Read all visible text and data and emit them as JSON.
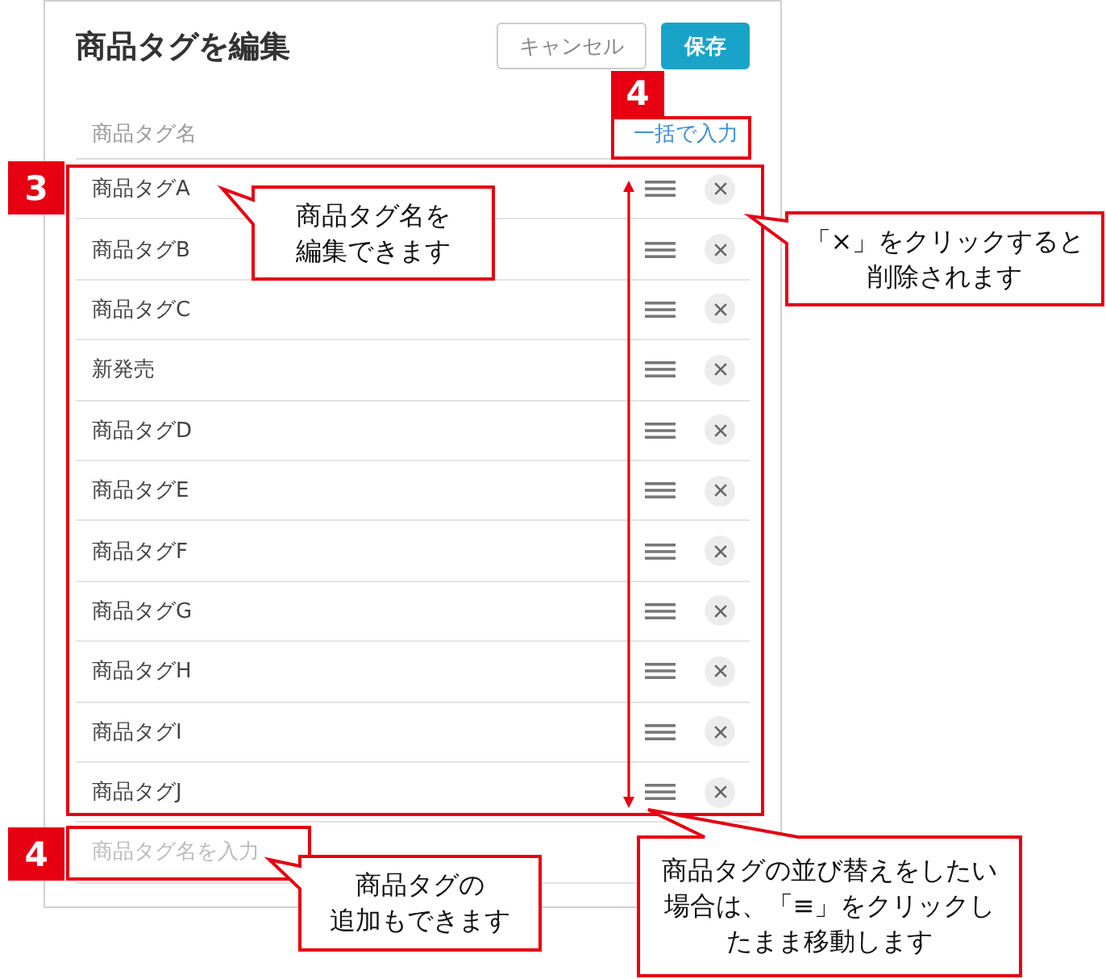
{
  "dialog": {
    "title": "商品タグを編集",
    "buttons": [
      {
        "label": "キャンセル",
        "kind": "secondary"
      },
      {
        "label": "保存",
        "kind": "primary"
      }
    ],
    "column_header": "商品タグ名",
    "bulk_input_link": "一括で入力",
    "tags": [
      "商品タグA",
      "商品タグB",
      "商品タグC",
      "新発売",
      "商品タグD",
      "商品タグE",
      "商品タグF",
      "商品タグG",
      "商品タグH",
      "商品タグI",
      "商品タグJ"
    ],
    "new_tag_field": {
      "placeholder": "商品タグ名を入力"
    }
  },
  "annotations": {
    "markers": [
      {
        "number": "4",
        "kind": "bulk_input"
      },
      {
        "number": "3",
        "kind": "tag_list"
      },
      {
        "number": "4",
        "kind": "new_tag_field"
      }
    ],
    "callouts": [
      {
        "lines": [
          "商品タグ名を",
          "編集できます"
        ],
        "kind": "tag_name"
      },
      {
        "lines": [
          "「×」をクリックすると",
          "削除されます"
        ],
        "kind": "delete_button"
      },
      {
        "lines": [
          "商品タグの",
          "追加もできます"
        ],
        "kind": "new_tag_field"
      },
      {
        "lines": [
          "商品タグの並び替えをしたい",
          "場合は、「≡」をクリックし",
          "たまま移動します"
        ],
        "kind": "drag_handle"
      }
    ]
  }
}
